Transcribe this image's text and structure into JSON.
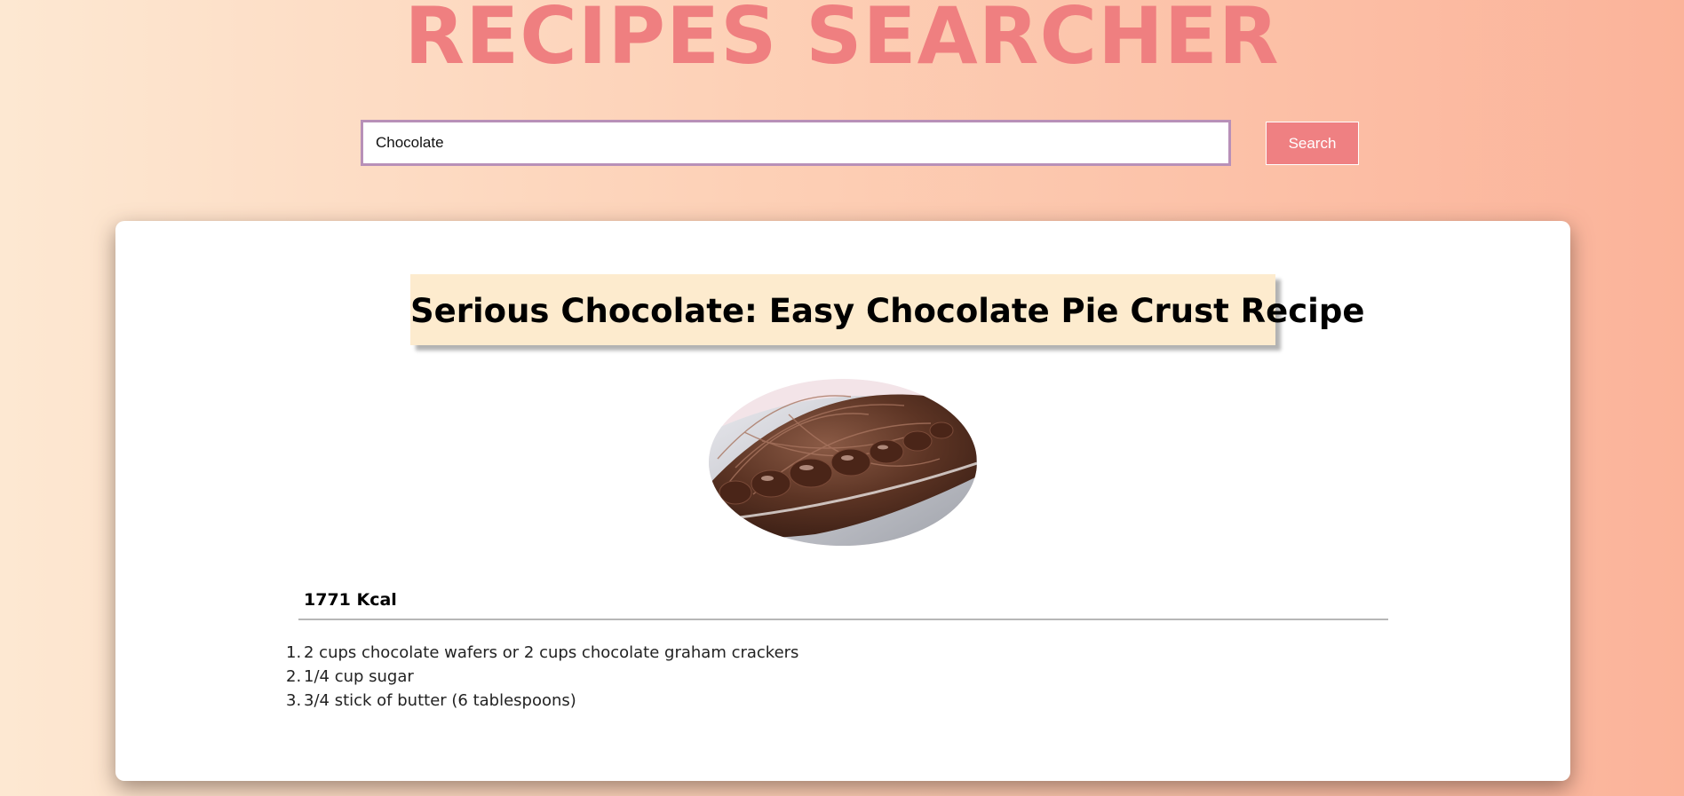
{
  "header": {
    "title": "RECIPES SEARCHER"
  },
  "search": {
    "value": "Chocolate",
    "placeholder": "",
    "button_label": "Search"
  },
  "recipe": {
    "title": "Serious Chocolate: Easy Chocolate Pie Crust Recipe",
    "image_alt": "chocolate pie crust",
    "calories": "1771 Kcal",
    "ingredients": [
      {
        "num": "1.",
        "text": "2 cups chocolate wafers or 2 cups chocolate graham crackers"
      },
      {
        "num": "2.",
        "text": "1/4 cup sugar"
      },
      {
        "num": "3.",
        "text": "3/4 stick of butter (6 tablespoons)"
      }
    ]
  },
  "colors": {
    "accent": "#ef7f80",
    "title_bg": "#fdebce",
    "input_border": "#b890b8"
  }
}
